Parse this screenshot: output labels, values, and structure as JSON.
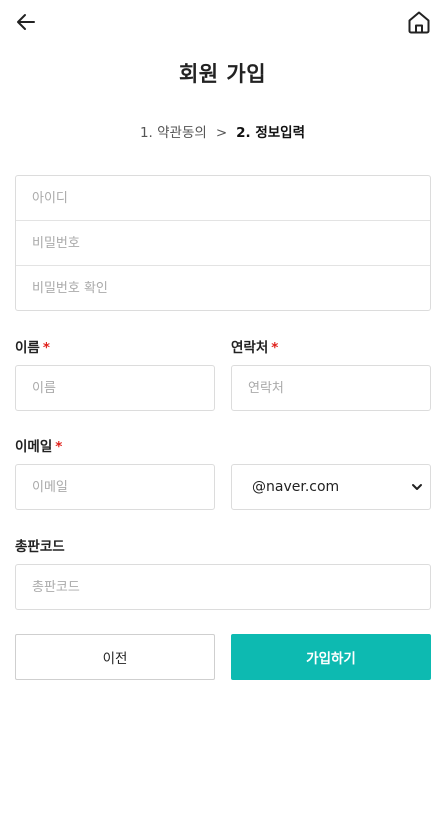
{
  "header": {
    "back_icon": "arrow-left-icon",
    "home_icon": "home-icon",
    "title": "회원 가입"
  },
  "steps": {
    "step1": "1. 약관동의",
    "separator": ">",
    "step2": "2. 정보입력"
  },
  "account": {
    "id_placeholder": "아이디",
    "password_placeholder": "비밀번호",
    "password_confirm_placeholder": "비밀번호 확인"
  },
  "name": {
    "label": "이름",
    "required_mark": "*",
    "placeholder": "이름"
  },
  "contact": {
    "label": "연락처",
    "required_mark": "*",
    "placeholder": "연락처"
  },
  "email": {
    "label": "이메일",
    "required_mark": "*",
    "placeholder": "이메일",
    "domain_selected": "@naver.com"
  },
  "distributor": {
    "label": "총판코드",
    "placeholder": "총판코드"
  },
  "buttons": {
    "prev": "이전",
    "join": "가입하기"
  },
  "colors": {
    "accent": "#0dbab1",
    "required": "#e0201a"
  }
}
